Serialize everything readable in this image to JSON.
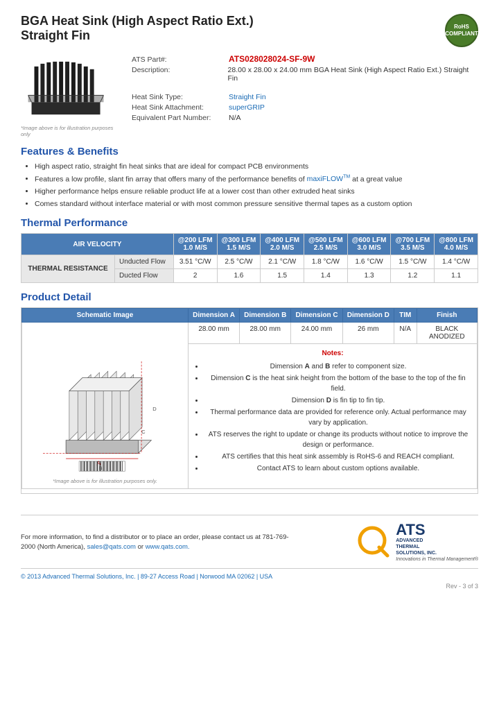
{
  "header": {
    "title_line1": "BGA Heat Sink (High Aspect Ratio Ext.)",
    "title_line2": "Straight Fin",
    "rohs_label": "RoHS\nCOMPLIANT"
  },
  "product_specs": {
    "part_num_label": "ATS Part#:",
    "part_num_value": "ATS028028024-SF-9W",
    "description_label": "Description:",
    "description_value": "28.00 x 28.00 x 24.00 mm  BGA Heat Sink (High Aspect Ratio Ext.) Straight Fin",
    "heatsink_type_label": "Heat Sink Type:",
    "heatsink_type_value": "Straight Fin",
    "attachment_label": "Heat Sink Attachment:",
    "attachment_value": "superGRIP",
    "equiv_part_label": "Equivalent Part Number:",
    "equiv_part_value": "N/A",
    "image_note": "*Image above is for illustration purposes only"
  },
  "features": {
    "section_title": "Features & Benefits",
    "items": [
      "High aspect ratio, straight fin heat sinks that are ideal for compact PCB environments",
      "Features a low profile, slant fin array that offers many of the performance benefits of maxiFLOW™ at a great value",
      "Higher performance helps ensure reliable product life at a lower cost than other extruded heat sinks",
      "Comes standard without interface material or with most common pressure sensitive thermal tapes as a custom option"
    ]
  },
  "thermal_performance": {
    "section_title": "Thermal Performance",
    "air_velocity_label": "AIR VELOCITY",
    "columns": [
      {
        "label": "@200 LFM",
        "sub": "1.0 M/S"
      },
      {
        "label": "@300 LFM",
        "sub": "1.5 M/S"
      },
      {
        "label": "@400 LFM",
        "sub": "2.0 M/S"
      },
      {
        "label": "@500 LFM",
        "sub": "2.5 M/S"
      },
      {
        "label": "@600 LFM",
        "sub": "3.0 M/S"
      },
      {
        "label": "@700 LFM",
        "sub": "3.5 M/S"
      },
      {
        "label": "@800 LFM",
        "sub": "4.0 M/S"
      }
    ],
    "thermal_resistance_label": "THERMAL RESISTANCE",
    "rows": [
      {
        "label": "Unducted Flow",
        "values": [
          "3.51 °C/W",
          "2.5 °C/W",
          "2.1 °C/W",
          "1.8 °C/W",
          "1.6 °C/W",
          "1.5 °C/W",
          "1.4 °C/W"
        ]
      },
      {
        "label": "Ducted Flow",
        "values": [
          "2",
          "1.6",
          "1.5",
          "1.4",
          "1.3",
          "1.2",
          "1.1"
        ]
      }
    ]
  },
  "product_detail": {
    "section_title": "Product Detail",
    "columns": [
      "Schematic Image",
      "Dimension A",
      "Dimension B",
      "Dimension C",
      "Dimension D",
      "TIM",
      "Finish"
    ],
    "dimension_values": [
      "28.00 mm",
      "28.00 mm",
      "24.00 mm",
      "26 mm",
      "N/A",
      "BLACK ANODIZED"
    ],
    "schematic_note": "*Image above is for illustration purposes only.",
    "notes_title": "Notes:",
    "notes": [
      "Dimension A and B refer to component size.",
      "Dimension C is the heat sink height from the bottom of the base to the top of the fin field.",
      "Dimension D is fin tip to fin tip.",
      "Thermal performance data are provided for reference only. Actual performance may vary by application.",
      "ATS reserves the right to update or change its products without notice to improve the design or performance.",
      "ATS certifies that this heat sink assembly is RoHS-6 and REACH compliant.",
      "Contact ATS to learn about custom options available."
    ]
  },
  "footer": {
    "contact_text": "For more information, to find a distributor or to place an order, please contact us at 781-769-2000 (North America),",
    "email": "sales@qats.com",
    "or_text": "or",
    "website": "www.qats.com.",
    "copyright": "© 2013 Advanced Thermal Solutions, Inc.  |  89-27 Access Road  |  Norwood MA  02062  |  USA",
    "ats_name": "ATS",
    "ats_full": "ADVANCED\nTHERMAL\nSOLUTIONS, INC.",
    "ats_tagline": "Innovations in Thermal Management®",
    "page_num": "Rev - 3 of 3"
  }
}
